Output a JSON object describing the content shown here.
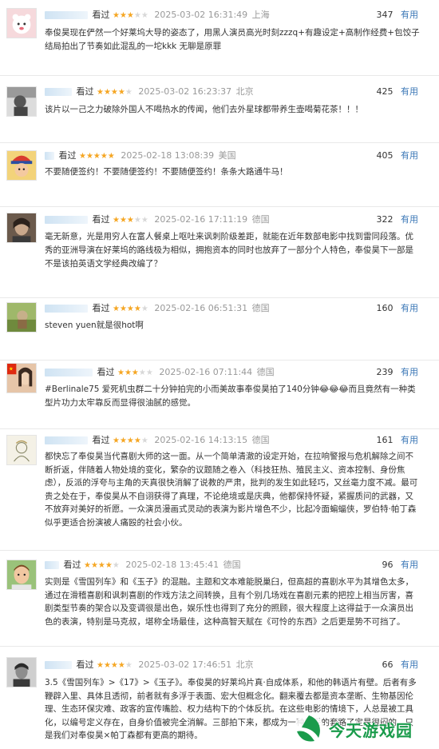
{
  "reviews": [
    {
      "watched": "看过",
      "stars": 3,
      "time": "2025-03-02 16:31:49",
      "location": "上海",
      "votes": "347",
      "useful": "有用",
      "text": "奉俊昊现在俨然一个好莱坞大导的姿态了，用黑人演员高光时刻zzzq+有趣设定+高制作经费+包饺子结局拍出了节奏如此混乱的一坨kkk 无聊是原罪"
    },
    {
      "watched": "看过",
      "stars": 4,
      "time": "2025-03-02 16:23:37",
      "location": "北京",
      "votes": "425",
      "useful": "有用",
      "text": "该片以一己之力破除外国人不喝热水的传闻，他们去外星球都带养生壶喝菊花茶！！！"
    },
    {
      "watched": "看过",
      "stars": 5,
      "time": "2025-02-18 13:08:39",
      "location": "美国",
      "votes": "405",
      "useful": "有用",
      "text": "不要随便签约！不要随便签约！不要随便签约！条条大路通牛马！"
    },
    {
      "watched": "看过",
      "stars": 3,
      "time": "2025-02-16 17:11:19",
      "location": "德国",
      "votes": "322",
      "useful": "有用",
      "text": "毫无新意，光是用穷人在富人餐桌上呕吐来讽刺阶级差距，就能在近年数部电影中找到雷同段落。优秀的亚洲导演在好莱坞的路线极为相似，拥抱资本的同时也放弃了一部分个人特色，奉俊昊下一部是不是该拍英语文学经典改编了？"
    },
    {
      "watched": "看过",
      "stars": 4,
      "time": "2025-02-16 06:51:31",
      "location": "德国",
      "votes": "160",
      "useful": "有用",
      "text": "steven yuen就是很hot啊"
    },
    {
      "watched": "看过",
      "stars": 3,
      "time": "2025-02-16 07:11:44",
      "location": "德国",
      "votes": "239",
      "useful": "有用",
      "text": "#Berlinale75 爱死机虫群二十分钟拍完的小而美故事奉俊昊拍了140分钟😂😂😂而且竟然有一种类型片功力太牢靠反而显得很油腻的感觉。"
    },
    {
      "watched": "看过",
      "stars": 4,
      "time": "2025-02-16 14:13:15",
      "location": "德国",
      "votes": "161",
      "useful": "有用",
      "text": "都快忘了奉俊昊当代喜剧大师的这一面。从一个简单清澈的设定开始，在拉响警报与危机解除之间不断折返，伴随着人物处境的变化，繁杂的议题随之卷入（科技狂热、殖民主义、资本控制、身份焦虑），反派的浮夸与主角的天真很快消解了说教的严肃，批判的发生如此轻巧，又丝毫力度不减。最可贵之处在于，奉俊昊从不自诩获得了真理，不论绝境或是庆典，他都保持怀疑，紧握质问的武器，又不放弃对美好的祈愿。一众演员漫画式灵动的表演为影片增色不少，比起冷面蝙蝠侠，罗伯特·帕丁森似乎更适合扮演被人痛殴的社会小伙。"
    },
    {
      "watched": "看过",
      "stars": 4,
      "time": "2025-02-18 13:45:41",
      "location": "德国",
      "votes": "96",
      "useful": "有用",
      "text": "实则是《雪国列车》和《玉子》的混融。主题和文本难能脱巢臼，但高超的喜剧水平为其增色太多，通过在滑稽喜剧和讽刺喜剧的作戏方法之间转换，且有个别几场戏在喜剧元素的把控上相当厉害，喜剧类型节奏的架合以及变调很是出色，娱乐性也得到了充分的照顾，很大程度上这得益于一众演员出色的表演，特别是马克叔，堪称全场最佳，这种高智天赋在《可怜的东西》之后更是势不可挡了。"
    },
    {
      "watched": "看过",
      "stars": 4,
      "time": "2025-03-02 17:46:51",
      "location": "北京",
      "votes": "66",
      "useful": "有用",
      "text": "3.5《雪国列车》>《17》>《玉子》。奉俊昊的好莱坞片真·自成体系，和他的韩语片有壁。后者有多鞭辟入里、具体且透彻，前者就有多浮于表面、宏大但概念化。翻来覆去都是资本垄断、生物基因伦理、生态环保灾难、政客的宣传嘴脸、权力结构下的个体反抗。在这些电影的情境下，人总是被工具化，以编号定义存在，自身价值被完全消解。三部拍下来，都成为一种稳妥的套路了定是很闷的，只是我们对奉俊昊×帕丁森都有更高的期待。"
    }
  ],
  "watermark": {
    "text": "今天游戏园",
    "icon": "leaf-logo-icon",
    "color": "#1a9b4b"
  },
  "colors": {
    "star": "#f5a623",
    "link": "#3b77b6",
    "muted": "#999999"
  }
}
